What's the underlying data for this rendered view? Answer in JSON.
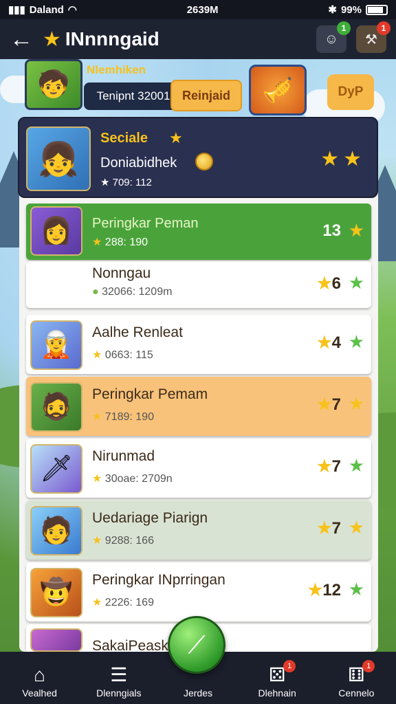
{
  "status_bar": {
    "carrier": "Daland",
    "time": "2639M",
    "battery": "99%"
  },
  "header": {
    "title": "INnnngaid",
    "badge_left": "1",
    "badge_right": "1"
  },
  "event": {
    "name": "Nlemhiken",
    "code": "Tenipnt 32001",
    "button": "Reinjaid",
    "right_button": "DyP"
  },
  "me": {
    "name": "Seciale",
    "label": "Doniabidhek",
    "score": "709: 112"
  },
  "rows": [
    {
      "name": "Peringkar Peman",
      "score": "288: 190",
      "rank": "13"
    },
    {
      "name": "Nonngau",
      "score": "32066: 1209m",
      "rank": "6"
    },
    {
      "name": "Aalhe Renleat",
      "score": "0663: 115",
      "rank": "4"
    },
    {
      "name": "Peringkar Pemam",
      "score": "7189: 190",
      "rank": "7"
    },
    {
      "name": "Nirunmad",
      "score": "30oae: 2709n",
      "rank": "7"
    },
    {
      "name": "Uedariage Piarign",
      "score": "9288: 166",
      "rank": "7"
    },
    {
      "name": "Peringkar INprringan",
      "score": "2226: 169",
      "rank": "12"
    },
    {
      "name": "SakaiPeask",
      "score": "",
      "rank": ""
    }
  ],
  "nav": [
    {
      "label": "Vealhed",
      "icon": "home-icon"
    },
    {
      "label": "Dlenngials",
      "icon": "list-icon"
    },
    {
      "label": "Jerdes",
      "icon": "play-icon"
    },
    {
      "label": "Dlehnain",
      "icon": "dice-icon",
      "badge": "1"
    },
    {
      "label": "Cennelo",
      "icon": "dice-icon",
      "badge": "1"
    }
  ]
}
